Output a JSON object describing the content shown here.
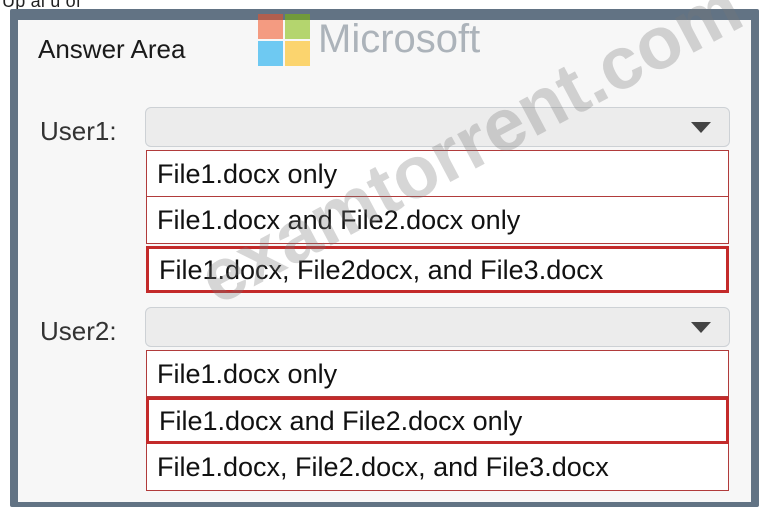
{
  "top_snippet": "Up al u of",
  "answer_area": {
    "title": "Answer Area",
    "watermark_logo_text": "Microsoft",
    "watermark_text": "examtorrent.com"
  },
  "users": [
    {
      "label": "User1:",
      "selected_value": "",
      "options": [
        {
          "label": "File1.docx only",
          "selected": false
        },
        {
          "label": "File1.docx and File2.docx only",
          "selected": false
        },
        {
          "label": "File1.docx, File2docx, and File3.docx",
          "selected": true
        }
      ]
    },
    {
      "label": "User2:",
      "selected_value": "",
      "options": [
        {
          "label": "File1.docx only",
          "selected": false
        },
        {
          "label": "File1.docx and File2.docx only",
          "selected": true
        },
        {
          "label": "File1.docx, File2.docx, and File3.docx",
          "selected": false
        }
      ]
    }
  ],
  "colors": {
    "frame": "#627384",
    "selection_border": "#c32a2a",
    "option_border": "#b13b3b",
    "logo_red": "#f25022",
    "logo_green": "#7fba00",
    "logo_blue": "#00a4ef",
    "logo_yellow": "#ffb900"
  },
  "icons": [
    "microsoft-logo-icon",
    "dropdown-arrow-icon"
  ]
}
